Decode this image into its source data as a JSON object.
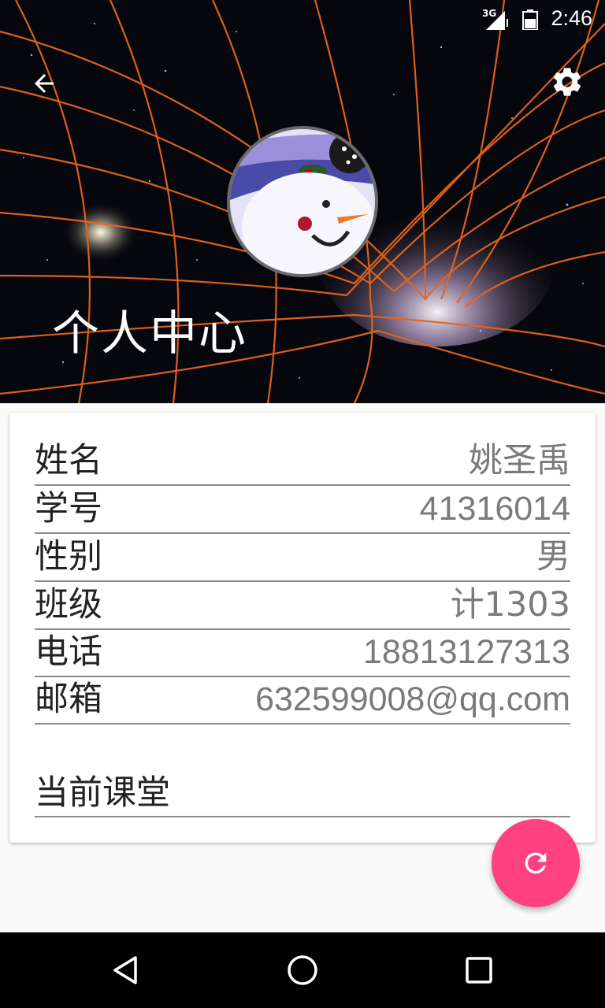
{
  "status_bar": {
    "network": "3G",
    "time": "2:46"
  },
  "header": {
    "title": "个人中心",
    "back_icon": "arrow-back-icon",
    "settings_icon": "gear-icon",
    "avatar": "snowman-avatar"
  },
  "profile": {
    "rows": [
      {
        "label": "姓名",
        "value": "姚圣禹"
      },
      {
        "label": "学号",
        "value": "41316014"
      },
      {
        "label": "性别",
        "value": "男"
      },
      {
        "label": "班级",
        "value": "计1303"
      },
      {
        "label": "电话",
        "value": "18813127313"
      },
      {
        "label": "邮箱",
        "value": "632599008@qq.com"
      }
    ],
    "current_class_label": "当前课堂"
  },
  "fab": {
    "icon": "refresh-icon",
    "color": "#ff4081"
  },
  "nav": {
    "back": "nav-back-icon",
    "home": "nav-home-icon",
    "recents": "nav-recents-icon"
  }
}
